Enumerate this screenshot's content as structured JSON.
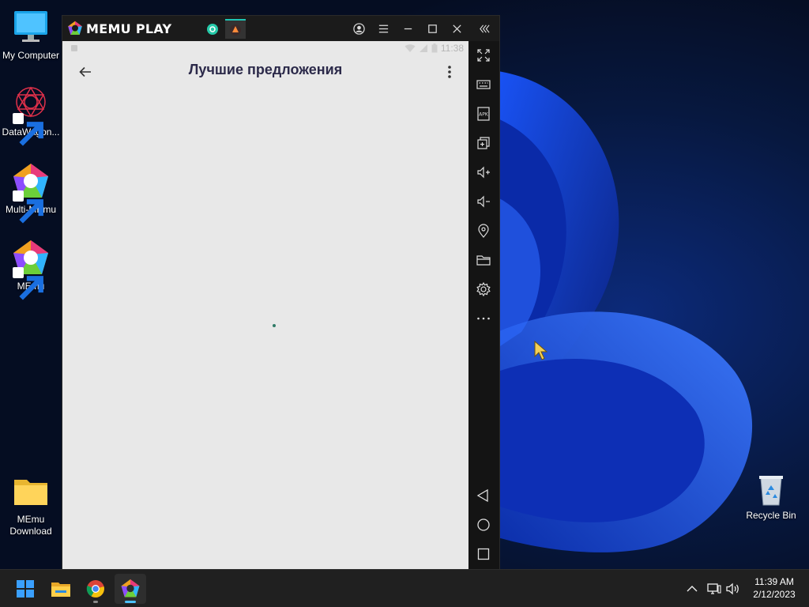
{
  "desktop": {
    "icons": [
      {
        "label": "My Computer",
        "icon": "monitor-icon"
      },
      {
        "label": "DataWagon...",
        "icon": "datawagon-icon"
      },
      {
        "label": "Multi-MEmu",
        "icon": "multi-memu-icon"
      },
      {
        "label": "MEmu",
        "icon": "memu-icon"
      },
      {
        "label": "MEmu\nDownload",
        "icon": "folder-icon"
      }
    ],
    "recycle_bin": {
      "label": "Recycle Bin",
      "icon": "recycle-bin-icon"
    }
  },
  "memu": {
    "logo_text": "MEMU PLAY",
    "tabs": [
      "app-tab-teal",
      "app-tab-orange"
    ],
    "title_buttons": [
      "account-icon",
      "menu-icon",
      "minimize-icon",
      "maximize-icon",
      "close-icon",
      "collapse-toolbar-icon"
    ]
  },
  "android": {
    "status_time": "11:38",
    "page_title": "Лучшие предложения"
  },
  "toolbar": {
    "items": [
      "fullscreen",
      "keyboard",
      "apk",
      "multi-window",
      "volume-up",
      "volume-down",
      "location",
      "files",
      "settings",
      "more",
      "nav-back",
      "nav-home",
      "nav-recents"
    ]
  },
  "taskbar": {
    "apps": [
      "start",
      "file-explorer",
      "chrome",
      "memu"
    ],
    "clock_time": "11:39 AM",
    "clock_date": "2/12/2023"
  },
  "colors": {
    "title_text": "#2c2a4a",
    "screen_bg": "#e8e8e8",
    "accent": "#4cc2ff"
  }
}
